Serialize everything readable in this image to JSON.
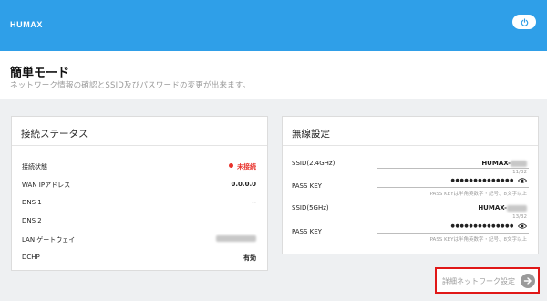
{
  "header": {
    "logo": "HUMAX",
    "power_button_icon": "power-icon",
    "bar_color": "#2f9fe8"
  },
  "page": {
    "title": "簡単モード",
    "subtitle": "ネットワーク情報の確認とSSID及びパスワードの変更が出来ます。"
  },
  "connection_status": {
    "title": "接続ステータス",
    "rows": [
      {
        "label": "接続状態",
        "value": "未接続",
        "status_color": "#e8312a"
      },
      {
        "label": "WAN IPアドレス",
        "value": "0.0.0.0"
      },
      {
        "label": "DNS 1",
        "value": "--"
      },
      {
        "label": "DNS 2",
        "value": ""
      },
      {
        "label": "LAN ゲートウェイ",
        "value": ""
      },
      {
        "label": "DCHP",
        "value": "有効"
      }
    ]
  },
  "wireless": {
    "title": "無線設定",
    "ssid_24": {
      "label": "SSID(2.4GHz)",
      "value": "HUMAX-",
      "counter": "11/32"
    },
    "pass_24": {
      "label": "PASS KEY",
      "value": "●●●●●●●●●●●●●●",
      "hint": "PASS KEYは半角英数字・記号、8文字以上"
    },
    "ssid_5": {
      "label": "SSID(5GHz)",
      "value": "HUMAX-",
      "counter": "13/32"
    },
    "pass_5": {
      "label": "PASS KEY",
      "value": "●●●●●●●●●●●●●●",
      "hint": "PASS KEYは半角英数字・記号、8文字以上"
    }
  },
  "advanced": {
    "label": "詳細ネットワーク設定",
    "icon": "arrow-right-icon",
    "highlight_color": "#e01818"
  }
}
